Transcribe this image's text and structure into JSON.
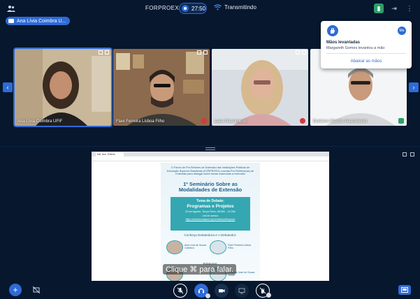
{
  "header": {
    "meeting_title": "FORPROEX",
    "timer": "27:50",
    "broadcast_status": "Transmitindo"
  },
  "presenter": {
    "label": "Ana Lívia Coimbra U..."
  },
  "participants": [
    {
      "name": "Ana Lívia Coimbra UFIF",
      "status": "speaking"
    },
    {
      "name": "Flavi Ferreira Lisboa Filho",
      "status": "muted"
    },
    {
      "name": "Lana Nascimento",
      "status": "muted"
    },
    {
      "name": "Durbens Martins Nascimento",
      "status": "camera"
    }
  ],
  "hands_popup": {
    "avatar_initials": "Ma",
    "title": "Mãos levantadas",
    "text": "Margareth Gomes levantou a mão",
    "link": "Abaixar as mãos"
  },
  "share": {
    "browser_tab": "Sal. Ano. Extens.",
    "address": "· · ·",
    "poster": {
      "intro": "O Fórum de Pró-Reitores de Extensão das Instituições Públicas de Educação Superior Brasileiras (FORPROEX) convida Pró-Reitores(as) de Extensão para dialogar sobre temas essenciais à extensão",
      "title_line1": "1º Seminário Sobre as",
      "title_line2": "Modalidades de Extensão",
      "debate_label": "Tema de Debate:",
      "debate_topic": "Programas e Projetos",
      "debate_time": "23 de Agosto, Terça-Feira, 08:30h - 11:00h",
      "access_label": "Link de acesso:",
      "access_link": "https://conferenciaweb.rnp.br/webconf/forproex",
      "section_debaters": "Conheça Debatedora e o Debatedor:",
      "debater1": "Ana Lívia de Souza Coimbra",
      "debater2": "Flavi Ferreira Lisboa Filho",
      "section_reporters": "Relatores:",
      "reporter2": "Durbens José do Souza Júnior"
    },
    "caption": "Clique ⌘ para falar."
  },
  "colors": {
    "background": "#06172e",
    "accent": "#2f6bd6",
    "poster_teal": "#34a7b2"
  }
}
